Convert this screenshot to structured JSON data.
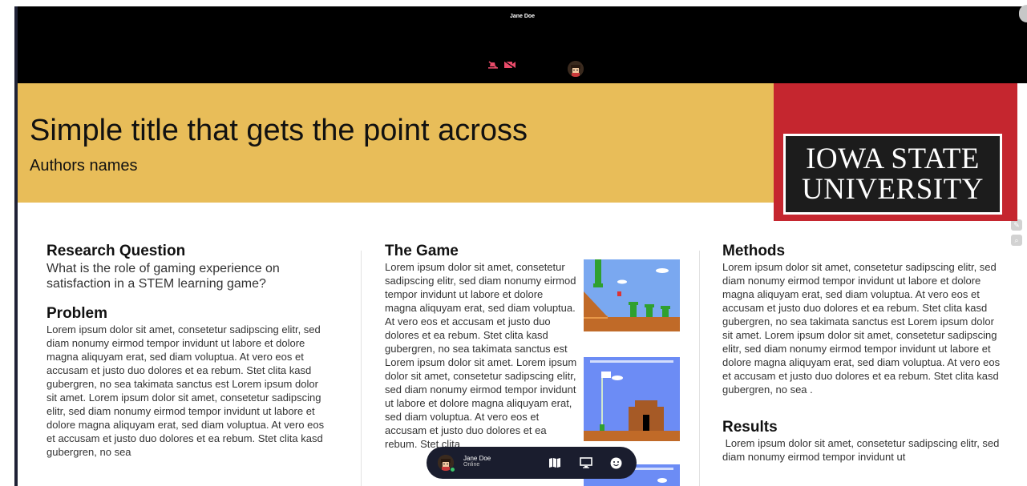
{
  "video": {
    "participant_name": "Jane Doe",
    "mic_state": "muted",
    "camera_state": "off"
  },
  "poster": {
    "title": "Simple title that gets the point across",
    "authors": "Authors names",
    "logo_line1": "IOWA STATE",
    "logo_line2": "UNIVERSITY",
    "colors": {
      "header_gold": "#e8bd59",
      "logo_red": "#c5262f",
      "logo_black": "#1c1c1c"
    },
    "research_question": {
      "heading": "Research Question",
      "text": "What is the role of gaming experience on satisfaction in a STEM learning game?"
    },
    "problem": {
      "heading": "Problem",
      "text": "Lorem ipsum dolor sit amet, consetetur sadipscing elitr, sed diam nonumy eirmod tempor invidunt ut labore et dolore magna aliquyam erat, sed diam voluptua. At vero eos et accusam et justo duo dolores et ea rebum. Stet clita kasd gubergren, no sea takimata sanctus est Lorem ipsum dolor sit amet. Lorem ipsum dolor sit amet, consetetur sadipscing elitr,  sed diam nonumy eirmod tempor invidunt ut labore et dolore magna aliquyam erat, sed diam voluptua. At vero eos et accusam et justo duo dolores et ea rebum. Stet clita kasd gubergren, no sea"
    },
    "game": {
      "heading": "The Game",
      "text": "Lorem ipsum dolor sit amet, consetetur sadipscing elitr, sed diam nonumy eirmod tempor invidunt ut labore et dolore magna aliquyam erat, sed diam voluptua. At vero eos et accusam et justo duo dolores et ea rebum. Stet clita kasd gubergren, no sea takimata sanctus est Lorem ipsum dolor sit amet. Lorem ipsum dolor sit amet, consetetur sadipscing elitr,  sed diam nonumy eirmod tempor invidunt ut labore et dolore magna aliquyam erat, sed diam voluptua. At vero eos et accusam et justo duo dolores et ea rebum. Stet clita"
    },
    "methods": {
      "heading": "Methods",
      "text": "Lorem ipsum dolor sit amet, consetetur sadipscing elitr, sed diam nonumy eirmod tempor invidunt ut labore et dolore magna aliquyam erat, sed diam voluptua. At vero eos et accusam et justo duo dolores et ea rebum. Stet clita kasd gubergren, no sea takimata sanctus est Lorem ipsum dolor sit amet. Lorem ipsum dolor sit amet, consetetur sadipscing elitr,  sed diam nonumy eirmod tempor invidunt ut labore et dolore magna aliquyam erat, sed diam voluptua. At vero eos et accusam et justo duo dolores et ea rebum. Stet clita kasd gubergren, no sea ."
    },
    "results": {
      "heading": "Results",
      "text": " Lorem ipsum dolor sit amet, consetetur sadipscing elitr, sed diam nonumy eirmod tempor invidunt ut"
    }
  },
  "call_bar": {
    "name": "Jane Doe",
    "status": "Online",
    "status_color": "#3cc76a",
    "buttons": [
      "map-icon",
      "screen-share-icon",
      "emoji-icon"
    ]
  }
}
